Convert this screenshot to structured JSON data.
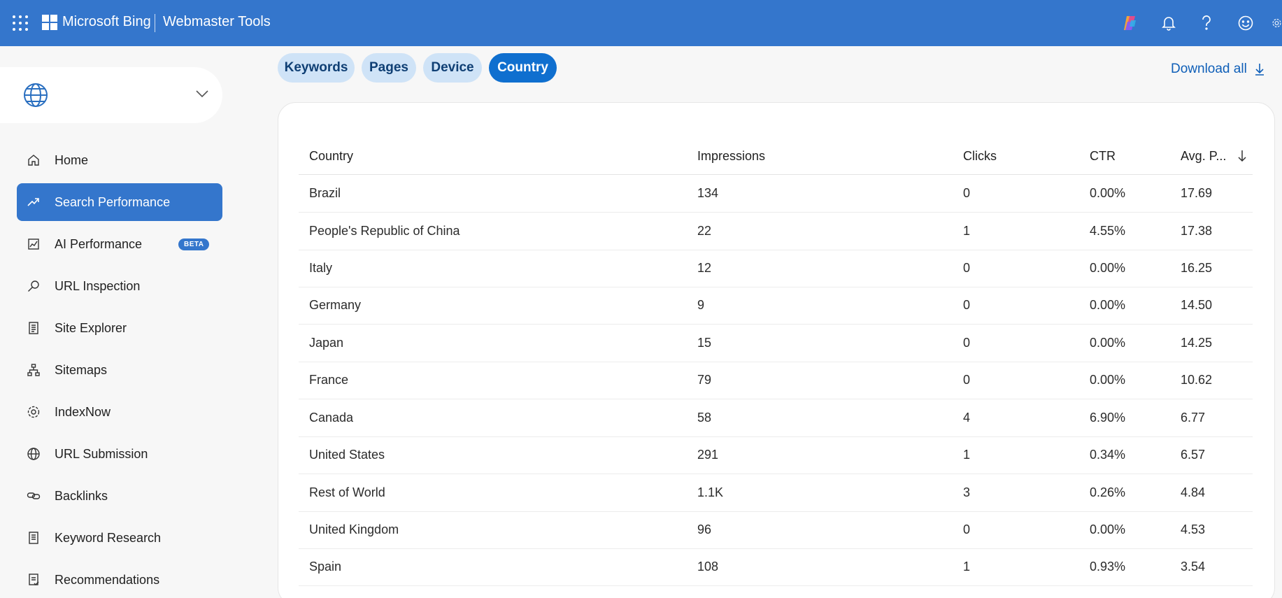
{
  "header": {
    "brand": "Microsoft Bing",
    "product": "Webmaster Tools",
    "icons": [
      "waffle-icon",
      "copilot-icon",
      "bell-icon",
      "help-icon",
      "smiley-icon",
      "settings-icon"
    ]
  },
  "sidebar": {
    "site_icon": "globe-icon",
    "items": [
      {
        "label": "Home",
        "icon": "home-icon",
        "active": false
      },
      {
        "label": "Search Performance",
        "icon": "trend-icon",
        "active": true
      },
      {
        "label": "AI Performance",
        "icon": "chart-frame-icon",
        "active": false,
        "badge": "BETA"
      },
      {
        "label": "URL Inspection",
        "icon": "search-icon",
        "active": false
      },
      {
        "label": "Site Explorer",
        "icon": "document-icon",
        "active": false
      },
      {
        "label": "Sitemaps",
        "icon": "sitemap-icon",
        "active": false
      },
      {
        "label": "IndexNow",
        "icon": "gear-icon",
        "active": false
      },
      {
        "label": "URL Submission",
        "icon": "globe-icon",
        "active": false
      },
      {
        "label": "Backlinks",
        "icon": "link-icon",
        "active": false
      },
      {
        "label": "Keyword Research",
        "icon": "list-document-icon",
        "active": false
      },
      {
        "label": "Recommendations",
        "icon": "checklist-icon",
        "active": false
      }
    ]
  },
  "tabs": [
    {
      "label": "Keywords",
      "active": false
    },
    {
      "label": "Pages",
      "active": false
    },
    {
      "label": "Device",
      "active": false
    },
    {
      "label": "Country",
      "active": true
    }
  ],
  "download_all": "Download all",
  "table": {
    "headers": {
      "country": "Country",
      "impressions": "Impressions",
      "clicks": "Clicks",
      "ctr": "CTR",
      "avg": "Avg. P..."
    },
    "sort": {
      "column": "avg",
      "direction": "descending"
    },
    "rows": [
      {
        "country": "Brazil",
        "impressions": "134",
        "clicks": "0",
        "ctr": "0.00%",
        "avg": "17.69"
      },
      {
        "country": "People's Republic of China",
        "impressions": "22",
        "clicks": "1",
        "ctr": "4.55%",
        "avg": "17.38"
      },
      {
        "country": "Italy",
        "impressions": "12",
        "clicks": "0",
        "ctr": "0.00%",
        "avg": "16.25"
      },
      {
        "country": "Germany",
        "impressions": "9",
        "clicks": "0",
        "ctr": "0.00%",
        "avg": "14.50"
      },
      {
        "country": "Japan",
        "impressions": "15",
        "clicks": "0",
        "ctr": "0.00%",
        "avg": "14.25"
      },
      {
        "country": "France",
        "impressions": "79",
        "clicks": "0",
        "ctr": "0.00%",
        "avg": "10.62"
      },
      {
        "country": "Canada",
        "impressions": "58",
        "clicks": "4",
        "ctr": "6.90%",
        "avg": "6.77"
      },
      {
        "country": "United States",
        "impressions": "291",
        "clicks": "1",
        "ctr": "0.34%",
        "avg": "6.57"
      },
      {
        "country": "Rest of World",
        "impressions": "1.1K",
        "clicks": "3",
        "ctr": "0.26%",
        "avg": "4.84"
      },
      {
        "country": "United Kingdom",
        "impressions": "96",
        "clicks": "0",
        "ctr": "0.00%",
        "avg": "4.53"
      },
      {
        "country": "Spain",
        "impressions": "108",
        "clicks": "1",
        "ctr": "0.93%",
        "avg": "3.54"
      }
    ]
  },
  "colors": {
    "brand_blue": "#3476cc",
    "tab_active": "#0f6fcf",
    "tab_inactive": "#cfe3f7",
    "link": "#0f5fb8"
  }
}
